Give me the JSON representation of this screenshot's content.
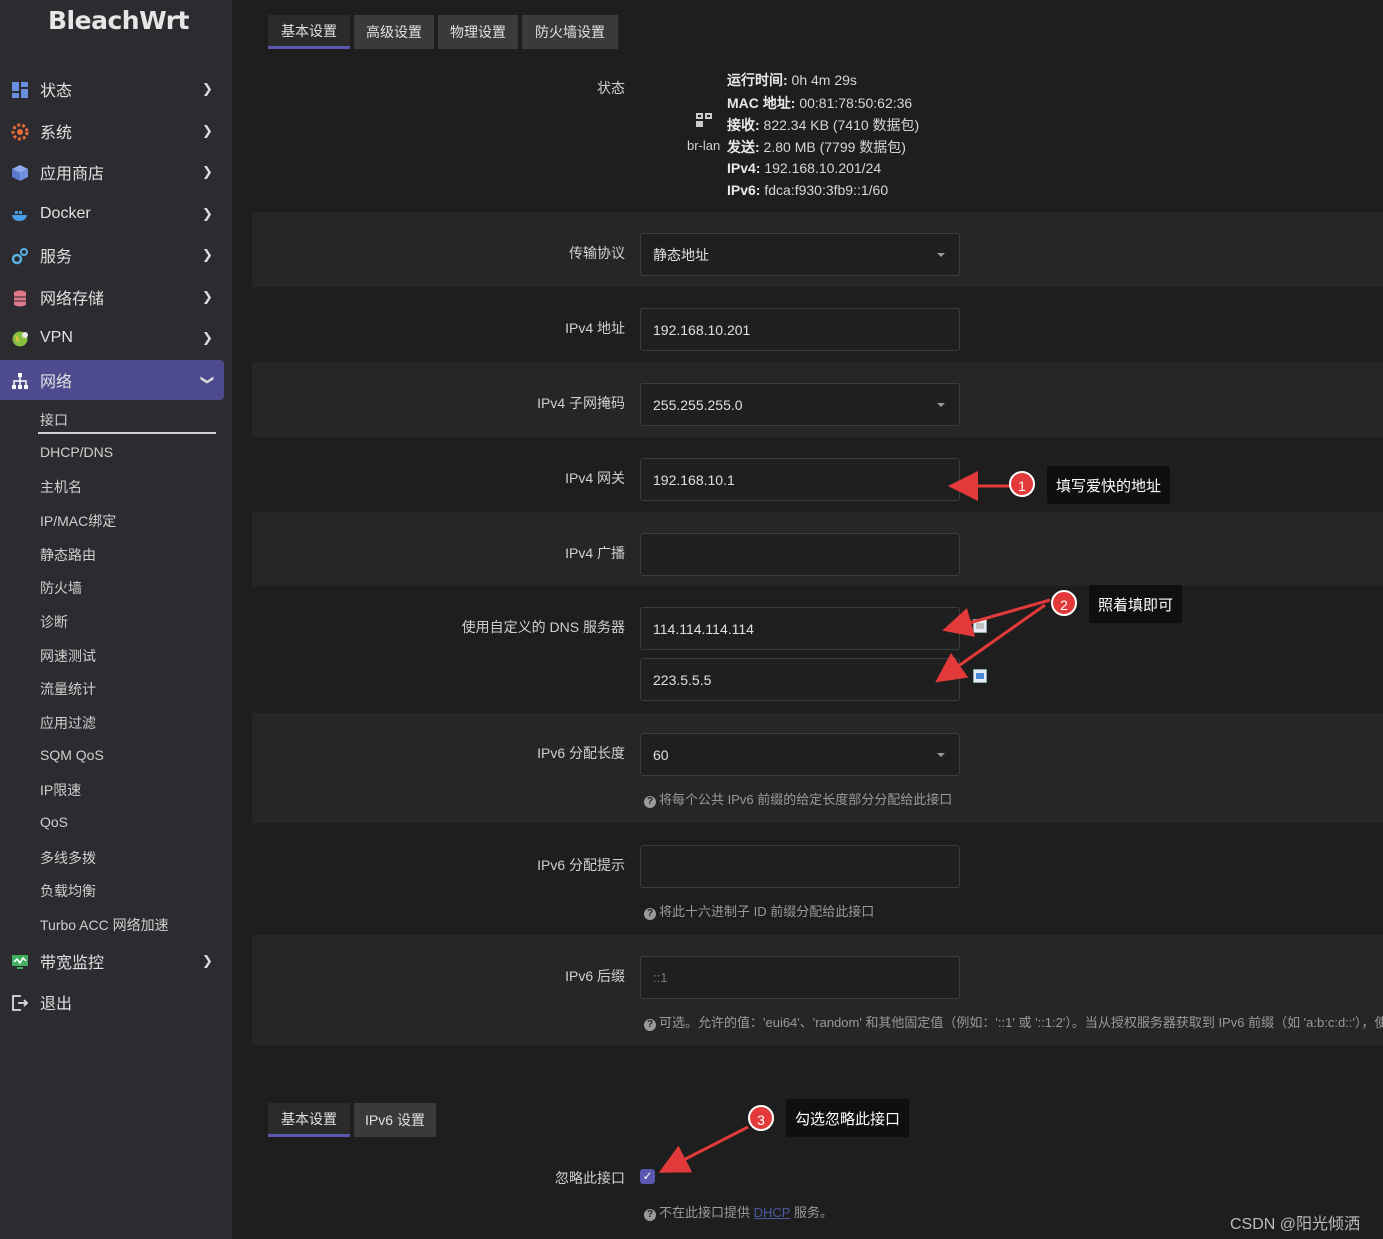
{
  "sidebar": {
    "brand": "BleachWrt",
    "items": [
      {
        "label": "状态",
        "icon": "dashboard-icon"
      },
      {
        "label": "系统",
        "icon": "gear-icon"
      },
      {
        "label": "应用商店",
        "icon": "cube-icon"
      },
      {
        "label": "Docker",
        "icon": "docker-icon"
      },
      {
        "label": "服务",
        "icon": "gears-icon"
      },
      {
        "label": "网络存储",
        "icon": "database-icon"
      },
      {
        "label": "VPN",
        "icon": "globe-icon"
      },
      {
        "label": "网络",
        "icon": "sitemap-icon"
      }
    ],
    "network_sub": [
      "接口",
      "DHCP/DNS",
      "主机名",
      "IP/MAC绑定",
      "静态路由",
      "防火墙",
      "诊断",
      "网速测试",
      "流量统计",
      "应用过滤",
      "SQM QoS",
      "IP限速",
      "QoS",
      "多线多拨",
      "负载均衡",
      "Turbo ACC 网络加速"
    ],
    "bandwidth": "带宽监控",
    "logout": "退出"
  },
  "tabs": [
    "基本设置",
    "高级设置",
    "物理设置",
    "防火墙设置"
  ],
  "status": {
    "label": "状态",
    "iface": "br-lan",
    "lines": [
      {
        "k": "运行时间:",
        "v": " 0h 4m 29s"
      },
      {
        "k": "MAC 地址:",
        "v": " 00:81:78:50:62:36"
      },
      {
        "k": "接收:",
        "v": " 822.34 KB (7410 数据包)"
      },
      {
        "k": "发送:",
        "v": " 2.80 MB (7799 数据包)"
      },
      {
        "k": "IPv4:",
        "v": " 192.168.10.201/24"
      },
      {
        "k": "IPv6:",
        "v": " fdca:f930:3fb9::1/60"
      }
    ]
  },
  "form": {
    "protocol": {
      "label": "传输协议",
      "value": "静态地址"
    },
    "ipv4_addr": {
      "label": "IPv4 地址",
      "value": "192.168.10.201"
    },
    "ipv4_mask": {
      "label": "IPv4 子网掩码",
      "value": "255.255.255.0"
    },
    "ipv4_gw": {
      "label": "IPv4 网关",
      "value": "192.168.10.1"
    },
    "ipv4_bcast": {
      "label": "IPv4 广播",
      "value": ""
    },
    "dns": {
      "label": "使用自定义的 DNS 服务器",
      "values": [
        "114.114.114.114",
        "223.5.5.5"
      ]
    },
    "ipv6_len": {
      "label": "IPv6 分配长度",
      "value": "60",
      "hint": "将每个公共 IPv6 前缀的给定长度部分分配给此接口"
    },
    "ipv6_hint": {
      "label": "IPv6 分配提示",
      "value": "",
      "hint": "将此十六进制子 ID 前缀分配给此接口"
    },
    "ipv6_suffix": {
      "label": "IPv6 后缀",
      "placeholder": "::1",
      "hint": "可选。允许的值：'eui64'、'random' 和其他固定值（例如：'::1' 或 '::1:2'）。当从授权服务器获取到 IPv6 前缀（如 'a:b:c:d::'），使"
    }
  },
  "dhcp": {
    "tabs": [
      "基本设置",
      "IPv6 设置"
    ],
    "ignore_label": "忽略此接口",
    "ignore_checked": true,
    "hint_pre": "不在此接口提供 ",
    "hint_link": "DHCP",
    "hint_post": " 服务。"
  },
  "annotations": [
    {
      "num": "1",
      "text": "填写爱快的地址"
    },
    {
      "num": "2",
      "text": "照着填即可"
    },
    {
      "num": "3",
      "text": "勾选忽略此接口"
    }
  ],
  "watermark": "CSDN @阳光倾洒",
  "colors": {
    "accent": "#5a58b0",
    "annotation": "#e23a3a",
    "sidebar": "#2c2c30"
  }
}
